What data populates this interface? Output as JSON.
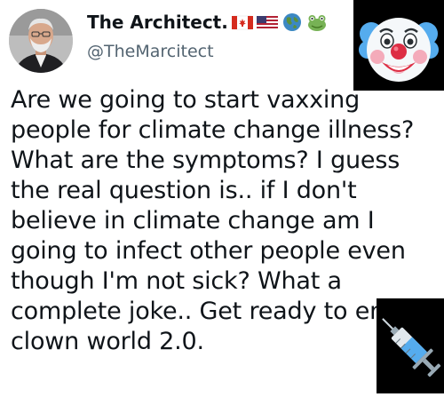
{
  "author": {
    "display_name": "The Architect.",
    "handle": "@TheMarcitect",
    "name_emojis": [
      "canada-flag-icon",
      "us-flag-icon",
      "globe-icon",
      "frog-icon"
    ]
  },
  "tweet": {
    "text": "Are we going to start vaxxing people for climate change illness? What are the symptoms?  I guess the real question is.. if I don't believe in climate change am I going to infect other people even though I'm not sick? What a complete joke.. Get ready to enter clown world 2.0."
  },
  "overlays": [
    "clown-face-emoji",
    "syringe-emoji"
  ],
  "colors": {
    "text": "#0f1419",
    "handle": "#536471",
    "background": "#ffffff",
    "overlay_bg": "#000000"
  }
}
